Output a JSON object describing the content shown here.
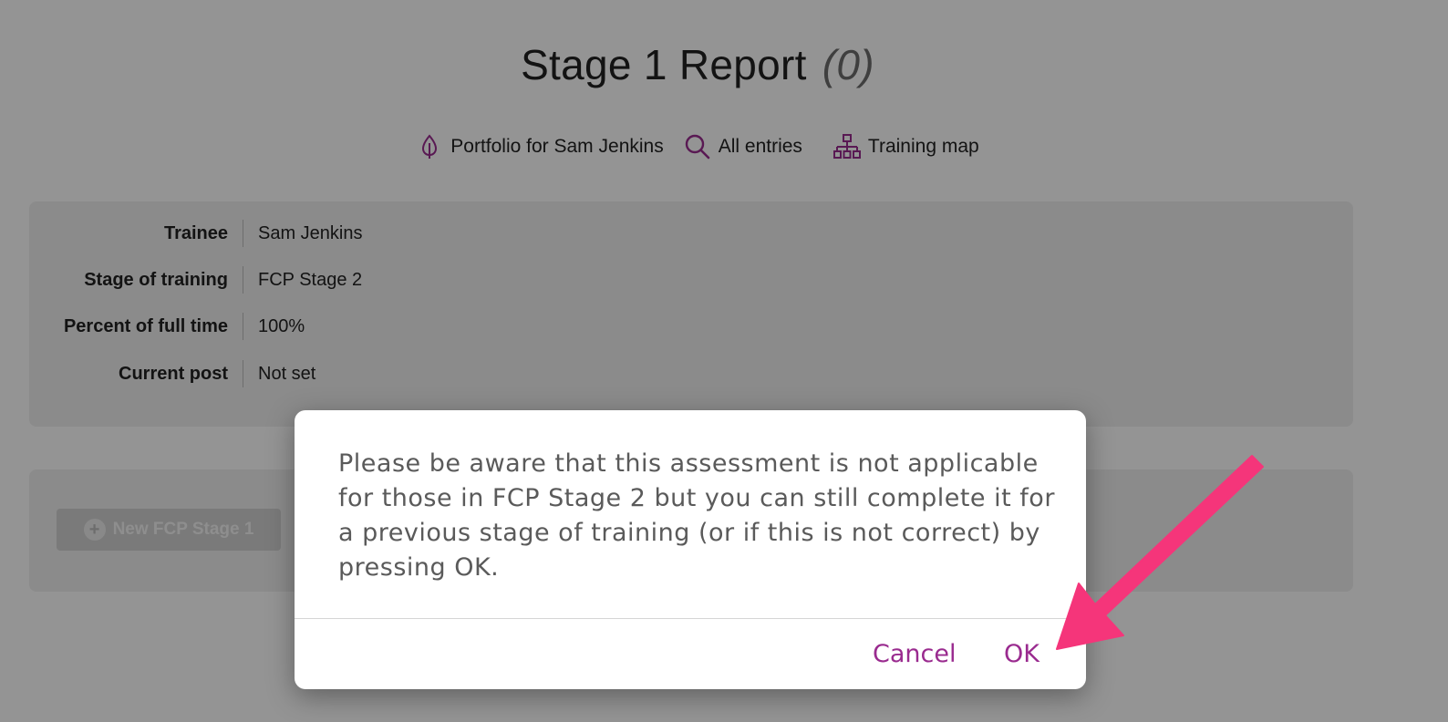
{
  "header": {
    "title": "Stage 1 Report",
    "count": "(0)"
  },
  "nav": {
    "portfolio_label": "Portfolio for Sam Jenkins",
    "entries_label": "All entries",
    "map_label": "Training map"
  },
  "info": {
    "rows": [
      {
        "label": "Trainee",
        "value": "Sam Jenkins"
      },
      {
        "label": "Stage of training",
        "value": "FCP Stage 2"
      },
      {
        "label": "Percent of full time",
        "value": "100%"
      },
      {
        "label": "Current post",
        "value": "Not set"
      }
    ]
  },
  "actions": {
    "new_label": "New FCP Stage 1"
  },
  "dialog": {
    "message": "Please be aware that this assessment is not applicable for those in FCP Stage 2 but you can still complete it for a previous stage of training (or if this is not correct) by pressing OK.",
    "cancel_label": "Cancel",
    "ok_label": "OK"
  },
  "colors": {
    "accent": "#9a2b8f",
    "arrow": "#f5357a",
    "overlay": "rgba(0,0,0,0.42)"
  },
  "icons": {
    "portfolio": "leaf-icon",
    "entries": "search-icon",
    "map": "sitemap-icon",
    "new": "plus-circle-icon"
  }
}
